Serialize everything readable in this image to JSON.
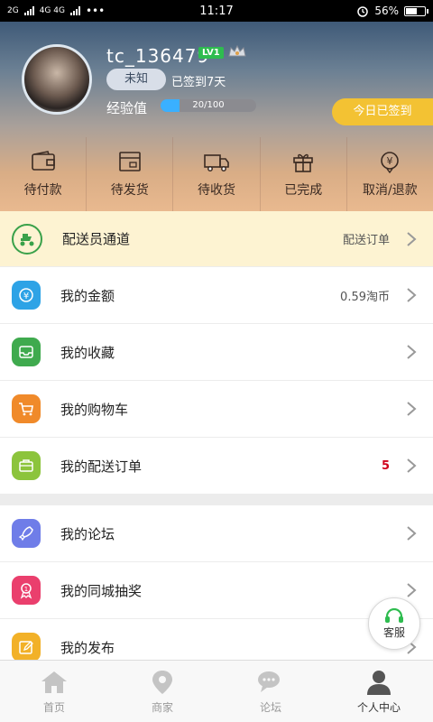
{
  "status_bar": {
    "network": "2G",
    "network2": "4G 4G",
    "dots": "•••",
    "time": "11:17",
    "battery": "56%"
  },
  "profile": {
    "username": "tc_136479",
    "level": "LV1",
    "badge": "未知",
    "signed_days": "已签到7天",
    "exp_label": "经验值",
    "exp_text": "20/100",
    "exp_fraction": 0.2,
    "signin_button": "今日已签到"
  },
  "orders": [
    {
      "label": "待付款",
      "icon": "wallet-icon"
    },
    {
      "label": "待发货",
      "icon": "package-icon"
    },
    {
      "label": "待收货",
      "icon": "truck-icon"
    },
    {
      "label": "已完成",
      "icon": "gift-icon"
    },
    {
      "label": "取消/退款",
      "icon": "refund-icon"
    }
  ],
  "menu": {
    "courier": {
      "label": "配送员通道",
      "right": "配送订单"
    },
    "balance": {
      "label": "我的金额",
      "right": "0.59淘币"
    },
    "favorites": {
      "label": "我的收藏"
    },
    "cart": {
      "label": "我的购物车"
    },
    "delivery_orders": {
      "label": "我的配送订单",
      "right": "5"
    },
    "forum": {
      "label": "我的论坛"
    },
    "lottery": {
      "label": "我的同城抽奖"
    },
    "posts": {
      "label": "我的发布"
    }
  },
  "service_button": "客服",
  "tabs": [
    {
      "label": "首页",
      "icon": "home-icon"
    },
    {
      "label": "商家",
      "icon": "location-icon"
    },
    {
      "label": "论坛",
      "icon": "chat-icon"
    },
    {
      "label": "个人中心",
      "icon": "person-icon"
    }
  ],
  "colors": {
    "accent_gold": "#f3c233",
    "level_green": "#2ebc4f",
    "badge_red": "#d0021b"
  }
}
